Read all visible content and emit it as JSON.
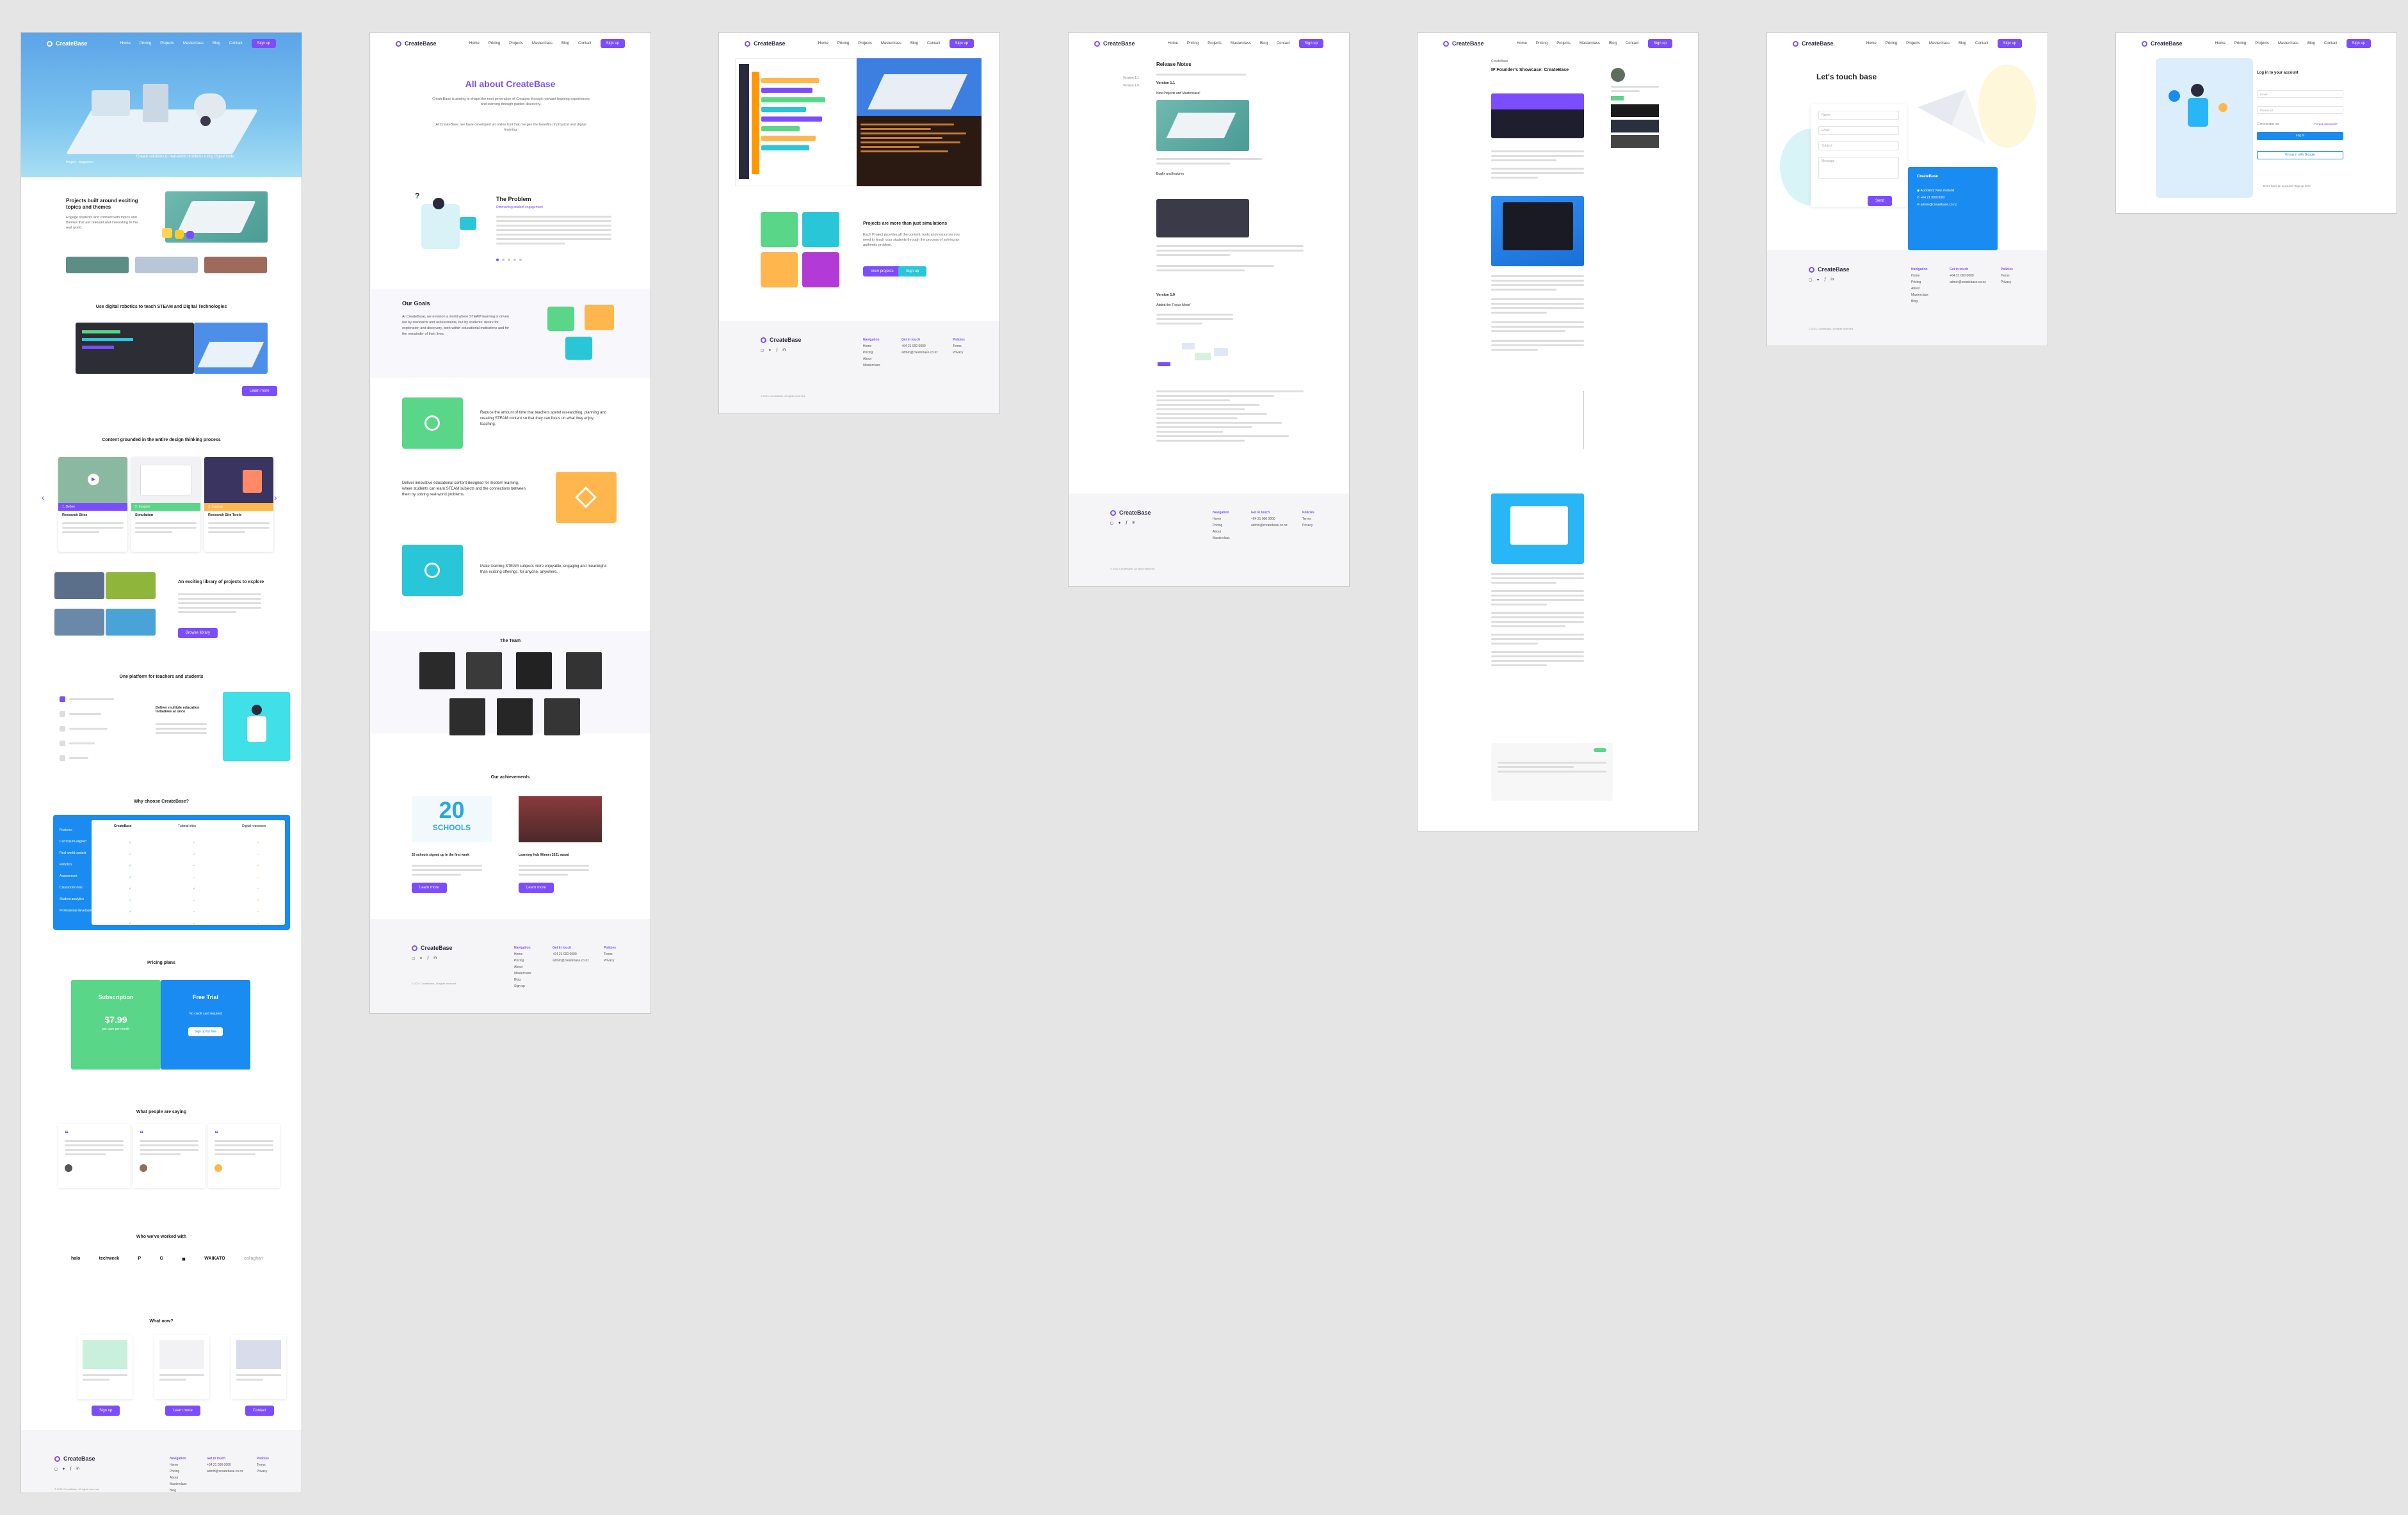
{
  "brand": "CreateBase",
  "nav": {
    "links": [
      "Home",
      "Pricing",
      "Projects",
      "Masterclass",
      "Blog",
      "Contact"
    ],
    "cta": "Sign up"
  },
  "home": {
    "hero_label": "Project - Magnetics",
    "hero_text": "Create solutions to real-world problems using digital tools",
    "s1_title": "Projects built around exciting topics and themes",
    "s1_text": "Engage students and connect with topics and themes that are relevant and interesting to the real world.",
    "s2_title": "Use digital robotics to teach STEAM and Digital Technologies",
    "s2_btn": "Learn more",
    "s3_title": "Content grounded in the Entire design thinking process",
    "s3_cards": [
      {
        "title": "Research Sites",
        "label": "1. Define"
      },
      {
        "title": "Simulation",
        "label": "2. Imagine"
      },
      {
        "title": "Research Site Tools",
        "label": "3. Improve"
      }
    ],
    "s4_title": "An exciting library of projects to explore",
    "s4_btn": "Browse library",
    "s5_title": "One platform for teachers and students",
    "s5_card_title": "Deliver multiple education initiatives at once",
    "s6_title": "Why choose CreateBase?",
    "s6_cols": [
      "CreateBase",
      "Tutorial sites",
      "Digital resources"
    ],
    "s6_rows": [
      "Features",
      "Curriculum-aligned",
      "Real-world context",
      "Robotics",
      "Assessment",
      "Classroom tools",
      "Student analytics",
      "Professional development"
    ],
    "s7_title": "Pricing plans",
    "s7_plans": [
      {
        "name": "Subscription",
        "price": "$7.99",
        "sub": "per user per month"
      },
      {
        "name": "Free Trial",
        "sub": "No credit card required",
        "btn": "Sign up for free"
      }
    ],
    "s8_title": "What people are saying",
    "s9_title": "Who we've worked with",
    "s9_logos": [
      "halo",
      "techweek",
      "P",
      "G",
      "◼",
      "WAIKATO",
      "callaghan"
    ],
    "s10_title": "What now?",
    "s10_btns": [
      "Sign up",
      "Learn more",
      "Contact"
    ]
  },
  "about": {
    "title_pre": "All about ",
    "title_brand": "CreateBase",
    "intro1": "CreateBase is aiming to shape the next generation of Creators through relevant learning experiences and learning through guided discovery.",
    "intro2": "At CreateBase, we have developed an online tool that merges the benefits of physical and digital learning.",
    "problem_title": "The Problem",
    "problem_sub": "Diminishing student engagement",
    "goals_title": "Our Goals",
    "goals_text": "At CreateBase, we envision a world where STEAM learning is driven not by standards and assessments, but by students' desire for exploration and discovery, both within educational institutions and for the remainder of their lives.",
    "goal1": "Reduce the amount of time that teachers spend researching, planning and creating STEAM content so that they can focus on what they enjoy, teaching.",
    "goal2": "Deliver innovative educational content designed for modern learning, where students can learn STEAM subjects and the connections between them by solving real-world problems.",
    "goal3": "Make learning STEAM subjects more enjoyable, engaging and meaningful than existing offerings, for anyone, anywhere.",
    "team_title": "The Team",
    "achieve_title": "Our achievements",
    "achieve_big": "20",
    "achieve_schools": "SCHOOLS",
    "achieve_cards": [
      "20 schools signed up in the first week",
      "Learning Hub Winner 2021 award"
    ],
    "achieve_btn": "Learn more"
  },
  "sim": {
    "title": "Projects are more than just simulations",
    "text": "Each Project provides all the content, tools and resources you need to teach your students through the process of solving an authentic problem.",
    "btns": [
      "View projects",
      "Sign up"
    ]
  },
  "notes": {
    "title": "Release Notes",
    "side": [
      "Version 1.1",
      "Version 1.0"
    ],
    "v11": "Version 1.1",
    "v10": "Version 1.0",
    "items": [
      "New Projects and Masterclass!",
      "Bugfix and features",
      "Added the 'Focus Mode'"
    ]
  },
  "blog": {
    "title": "IP Founder's Showcase: CreateBase",
    "author": "CreateBase"
  },
  "contact": {
    "title": "Let's touch base",
    "fields": [
      "Name",
      "Email",
      "Subject",
      "Message"
    ],
    "send": "Send",
    "info_title": "CreateBase",
    "info": [
      "Auckland, New Zealand",
      "+64 21 000 0000",
      "admin@createbase.co.nz"
    ]
  },
  "login": {
    "title": "Log in to your account",
    "fields": [
      "Email",
      "Password"
    ],
    "remember": "Remember me",
    "forgot": "Forgot password?",
    "btn": "Log in",
    "google": "Log in with Google",
    "signup": "Don't have an account? Sign up here"
  },
  "footer": {
    "cols": [
      {
        "title": "Navigation",
        "items": [
          "Home",
          "Pricing",
          "About",
          "Masterclass",
          "Blog",
          "Sign up"
        ]
      },
      {
        "title": "Get in touch",
        "items": [
          "+64 21 000 0000",
          "admin@createbase.co.nz"
        ]
      },
      {
        "title": "Policies",
        "items": [
          "Terms",
          "Privacy"
        ]
      }
    ],
    "copyright": "© 2021 CreateBase. All rights reserved."
  },
  "colors": {
    "purple": "#7c4dff",
    "teal": "#29c6d8",
    "green": "#5ad688",
    "blue": "#1a8bf0",
    "orange": "#ffb74d"
  }
}
